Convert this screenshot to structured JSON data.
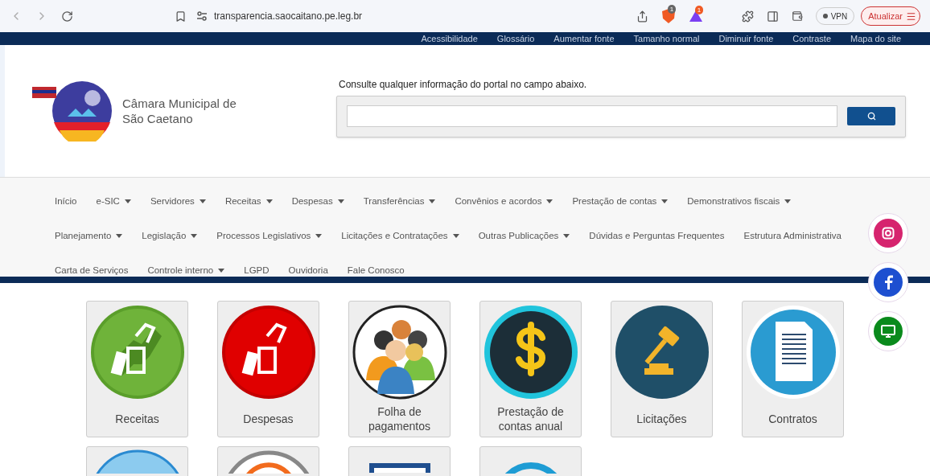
{
  "browser": {
    "url": "transparencia.saocaitano.pe.leg.br",
    "vpn": "VPN",
    "update": "Atualizar",
    "shield_badge": "1",
    "alert_badge": "1"
  },
  "accessibility_bar": {
    "items": [
      "Acessibilidade",
      "Glossário",
      "Aumentar fonte",
      "Tamanho normal",
      "Diminuir fonte",
      "Contraste",
      "Mapa do site"
    ]
  },
  "header": {
    "title": "Câmara Municipal de São Caetano",
    "search_label": "Consulte qualquer informação do portal no campo abaixo."
  },
  "nav": {
    "items": [
      {
        "label": "Início",
        "has_menu": false
      },
      {
        "label": "e-SIC",
        "has_menu": true
      },
      {
        "label": "Servidores",
        "has_menu": true
      },
      {
        "label": "Receitas",
        "has_menu": true
      },
      {
        "label": "Despesas",
        "has_menu": true
      },
      {
        "label": "Transferências",
        "has_menu": true
      },
      {
        "label": "Convênios e acordos",
        "has_menu": true
      },
      {
        "label": "Prestação de contas",
        "has_menu": true
      },
      {
        "label": "Demonstrativos fiscais",
        "has_menu": true
      },
      {
        "label": "Planejamento",
        "has_menu": true
      },
      {
        "label": "Legislação",
        "has_menu": true
      },
      {
        "label": "Processos Legislativos",
        "has_menu": true
      },
      {
        "label": "Licitações e Contratações",
        "has_menu": true
      },
      {
        "label": "Outras Publicações",
        "has_menu": true
      },
      {
        "label": "Dúvidas e Perguntas Frequentes",
        "has_menu": false
      },
      {
        "label": "Estrutura Administrativa",
        "has_menu": false
      },
      {
        "label": "Carta de Serviços",
        "has_menu": false
      },
      {
        "label": "Controle interno",
        "has_menu": true
      },
      {
        "label": "LGPD",
        "has_menu": false
      },
      {
        "label": "Ouvidoria",
        "has_menu": false
      },
      {
        "label": "Fale Conosco",
        "has_menu": false
      }
    ]
  },
  "social": [
    {
      "kind": "instagram",
      "color": "#d6246e"
    },
    {
      "kind": "facebook",
      "color": "#1d4fd0"
    },
    {
      "kind": "screen",
      "color": "#0a8a1c"
    }
  ],
  "tiles": [
    {
      "kind": "revenue",
      "label": "Receitas"
    },
    {
      "kind": "expense",
      "label": "Despesas"
    },
    {
      "kind": "people",
      "label": "Folha de pagamentos"
    },
    {
      "kind": "dollar",
      "label": "Prestação de contas anual"
    },
    {
      "kind": "gavel",
      "label": "Licitações"
    },
    {
      "kind": "document",
      "label": "Contratos"
    }
  ],
  "partial_tiles": [
    {
      "kind": "lightblue"
    },
    {
      "kind": "orange"
    },
    {
      "kind": "monitor"
    },
    {
      "kind": "teal"
    }
  ]
}
